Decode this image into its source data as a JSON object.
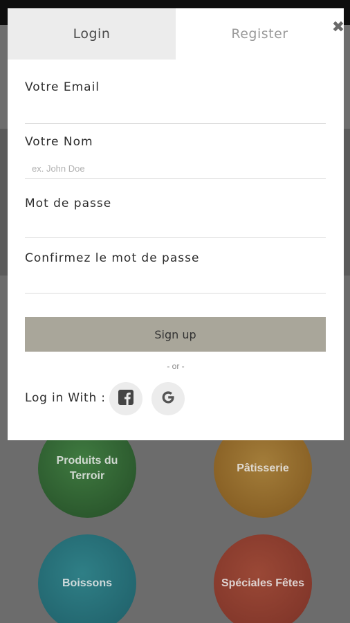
{
  "modal": {
    "tabs": {
      "login": "Login",
      "register": "Register"
    },
    "close_icon": "close-icon",
    "fields": {
      "email_label": "Votre Email",
      "email_placeholder": "",
      "name_label": "Votre Nom",
      "name_placeholder": "ex. John Doe",
      "password_label": "Mot de passe",
      "confirm_label": "Confirmez le mot de passe"
    },
    "signup_label": "Sign up",
    "or_text": "- or -",
    "login_with_label": "Log in With :",
    "social": {
      "facebook_icon": "facebook-icon",
      "google_icon": "google-icon"
    }
  },
  "categories": [
    {
      "label": "Produits du Terroir"
    },
    {
      "label": "Pâtisserie"
    },
    {
      "label": "Boissons"
    },
    {
      "label": "Spéciales Fêtes"
    }
  ],
  "colors": {
    "signup_button": "#a9a69a",
    "active_tab_bg": "#ececec",
    "overlay": "#6f6f6f"
  }
}
